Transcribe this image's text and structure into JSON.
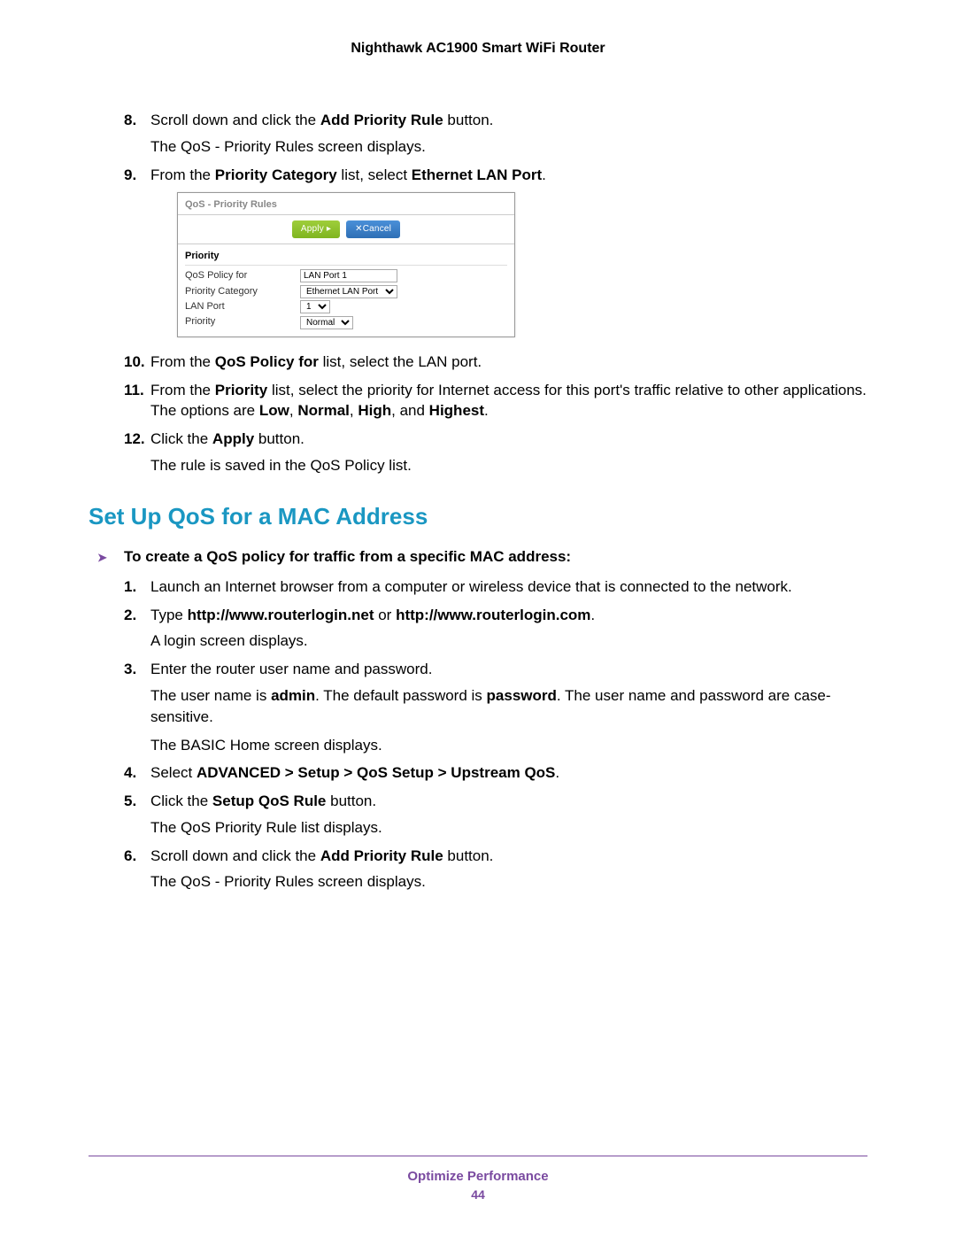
{
  "header": {
    "title": "Nighthawk AC1900 Smart WiFi Router"
  },
  "stepsA": [
    {
      "num": "8.",
      "prefix": "Scroll down and click the ",
      "bold1": "Add Priority Rule",
      "suffix": " button.",
      "follow": "The QoS - Priority Rules screen displays."
    },
    {
      "num": "9.",
      "prefix": "From the ",
      "bold1": "Priority Category",
      "mid": " list, select ",
      "bold2": "Ethernet LAN Port",
      "suffix": "."
    }
  ],
  "screenshot": {
    "title": "QoS - Priority Rules",
    "applyLabel": "Apply ▸",
    "cancelLabel": "✕Cancel",
    "sectionHeading": "Priority",
    "rows": {
      "policyLabel": "QoS Policy for",
      "policyValue": "LAN Port 1",
      "categoryLabel": "Priority Category",
      "categoryValue": "Ethernet LAN Port",
      "lanPortLabel": "LAN Port",
      "lanPortValue": "1",
      "priorityLabel": "Priority",
      "priorityValue": "Normal"
    }
  },
  "stepsB": [
    {
      "num": "10.",
      "prefix": "From the ",
      "bold1": "QoS Policy for",
      "suffix": " list, select the LAN port."
    },
    {
      "num": "11.",
      "prefix": "From the ",
      "bold1": "Priority",
      "mid": " list, select the priority for Internet access for this port's traffic relative to other applications. The options are ",
      "bold2": "Low",
      "mid2": ", ",
      "bold3": "Normal",
      "mid3": ", ",
      "bold4": "High",
      "mid4": ", and ",
      "bold5": "Highest",
      "suffix": "."
    },
    {
      "num": "12.",
      "prefix": "Click the ",
      "bold1": "Apply",
      "suffix": " button.",
      "bsuffix": ".",
      "follow": "The rule is saved in the QoS Policy list."
    }
  ],
  "section2": {
    "heading": "Set Up QoS for a MAC Address",
    "intro": "To create a QoS policy for traffic from a specific MAC address:"
  },
  "stepsC": [
    {
      "num": "1.",
      "text": "Launch an Internet browser from a computer or wireless device that is connected to the network."
    },
    {
      "num": "2.",
      "prefix": "Type ",
      "bold1": "http://www.routerlogin.net",
      "mid": " or ",
      "bold2": "http://www.routerlogin.com",
      "suffix": ".",
      "follow": "A login screen displays."
    },
    {
      "num": "3.",
      "text": "Enter the router user name and password.",
      "followA": "The user name is ",
      "followBold1": "admin",
      "followB": ". The default password is ",
      "followBold2": "password",
      "followC": ". The user name and password are case-sensitive.",
      "follow2": "The BASIC Home screen displays."
    },
    {
      "num": "4.",
      "prefix": "Select ",
      "bold1": "ADVANCED > Setup > QoS Setup > Upstream QoS",
      "suffix": "."
    },
    {
      "num": "5.",
      "prefix": "Click the ",
      "bold1": "Setup QoS Rule",
      "suffix": " button.",
      "follow": "The QoS Priority Rule list displays."
    },
    {
      "num": "6.",
      "prefix": "Scroll down and click the ",
      "bold1": "Add Priority Rule",
      "suffix": " button.",
      "follow": "The QoS - Priority Rules screen displays."
    }
  ],
  "footer": {
    "title": "Optimize Performance",
    "page": "44"
  }
}
